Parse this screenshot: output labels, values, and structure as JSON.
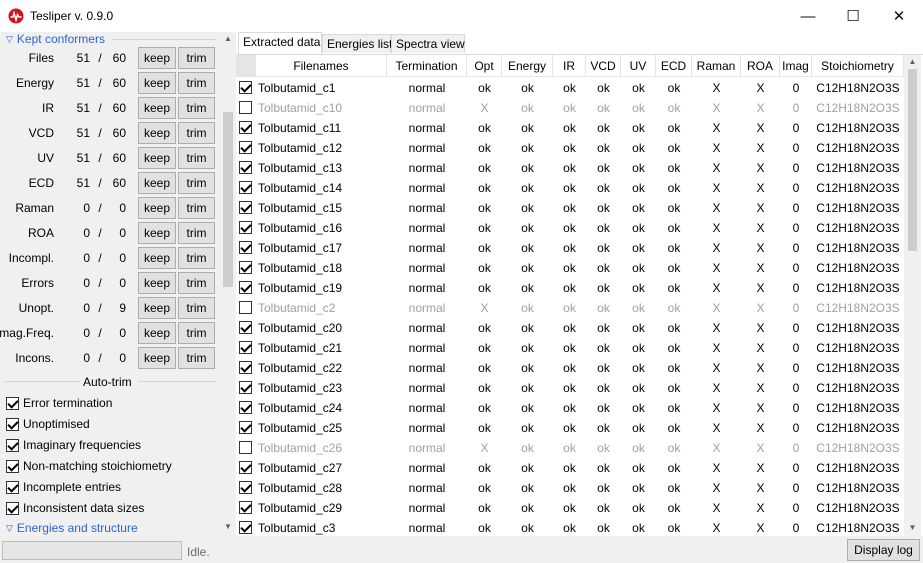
{
  "window": {
    "title": "Tesliper v. 0.9.0",
    "min_glyph": "—",
    "max_glyph": "☐",
    "close_glyph": "✕"
  },
  "left_panel": {
    "kept_conformers": {
      "label": "Kept conformers",
      "rows": [
        {
          "label": "Files",
          "kept": "51",
          "total": "60",
          "keep": "keep",
          "trim": "trim"
        },
        {
          "label": "Energy",
          "kept": "51",
          "total": "60",
          "keep": "keep",
          "trim": "trim"
        },
        {
          "label": "IR",
          "kept": "51",
          "total": "60",
          "keep": "keep",
          "trim": "trim"
        },
        {
          "label": "VCD",
          "kept": "51",
          "total": "60",
          "keep": "keep",
          "trim": "trim"
        },
        {
          "label": "UV",
          "kept": "51",
          "total": "60",
          "keep": "keep",
          "trim": "trim"
        },
        {
          "label": "ECD",
          "kept": "51",
          "total": "60",
          "keep": "keep",
          "trim": "trim"
        },
        {
          "label": "Raman",
          "kept": "0",
          "total": "0",
          "keep": "keep",
          "trim": "trim"
        },
        {
          "label": "ROA",
          "kept": "0",
          "total": "0",
          "keep": "keep",
          "trim": "trim"
        },
        {
          "label": "Incompl.",
          "kept": "0",
          "total": "0",
          "keep": "keep",
          "trim": "trim"
        },
        {
          "label": "Errors",
          "kept": "0",
          "total": "0",
          "keep": "keep",
          "trim": "trim"
        },
        {
          "label": "Unopt.",
          "kept": "0",
          "total": "9",
          "keep": "keep",
          "trim": "trim"
        },
        {
          "label": "Imag.Freq.",
          "kept": "0",
          "total": "0",
          "keep": "keep",
          "trim": "trim"
        },
        {
          "label": "Incons.",
          "kept": "0",
          "total": "0",
          "keep": "keep",
          "trim": "trim"
        }
      ],
      "separator": "/"
    },
    "auto_trim": {
      "label": "Auto-trim",
      "options": [
        {
          "label": "Error termination",
          "checked": true
        },
        {
          "label": "Unoptimised",
          "checked": true
        },
        {
          "label": "Imaginary frequencies",
          "checked": true
        },
        {
          "label": "Non-matching stoichiometry",
          "checked": true
        },
        {
          "label": "Incomplete entries",
          "checked": true
        },
        {
          "label": "Inconsistent data sizes",
          "checked": true
        }
      ]
    },
    "energies_structure": {
      "label": "Energies and structure"
    }
  },
  "tabs": [
    {
      "label": "Extracted data",
      "active": true
    },
    {
      "label": "Energies list",
      "active": false
    },
    {
      "label": "Spectra view",
      "active": false
    }
  ],
  "table": {
    "headers": [
      "",
      "Filenames",
      "Termination",
      "Opt",
      "Energy",
      "IR",
      "VCD",
      "UV",
      "ECD",
      "Raman",
      "ROA",
      "Imag",
      "Stoichiometry"
    ],
    "rows": [
      {
        "checked": true,
        "cells": [
          "Tolbutamid_c1",
          "normal",
          "ok",
          "ok",
          "ok",
          "ok",
          "ok",
          "ok",
          "X",
          "X",
          "0",
          "C12H18N2O3S"
        ]
      },
      {
        "checked": false,
        "cells": [
          "Tolbutamid_c10",
          "normal",
          "X",
          "ok",
          "ok",
          "ok",
          "ok",
          "ok",
          "X",
          "X",
          "0",
          "C12H18N2O3S"
        ]
      },
      {
        "checked": true,
        "cells": [
          "Tolbutamid_c11",
          "normal",
          "ok",
          "ok",
          "ok",
          "ok",
          "ok",
          "ok",
          "X",
          "X",
          "0",
          "C12H18N2O3S"
        ]
      },
      {
        "checked": true,
        "cells": [
          "Tolbutamid_c12",
          "normal",
          "ok",
          "ok",
          "ok",
          "ok",
          "ok",
          "ok",
          "X",
          "X",
          "0",
          "C12H18N2O3S"
        ]
      },
      {
        "checked": true,
        "cells": [
          "Tolbutamid_c13",
          "normal",
          "ok",
          "ok",
          "ok",
          "ok",
          "ok",
          "ok",
          "X",
          "X",
          "0",
          "C12H18N2O3S"
        ]
      },
      {
        "checked": true,
        "cells": [
          "Tolbutamid_c14",
          "normal",
          "ok",
          "ok",
          "ok",
          "ok",
          "ok",
          "ok",
          "X",
          "X",
          "0",
          "C12H18N2O3S"
        ]
      },
      {
        "checked": true,
        "cells": [
          "Tolbutamid_c15",
          "normal",
          "ok",
          "ok",
          "ok",
          "ok",
          "ok",
          "ok",
          "X",
          "X",
          "0",
          "C12H18N2O3S"
        ]
      },
      {
        "checked": true,
        "cells": [
          "Tolbutamid_c16",
          "normal",
          "ok",
          "ok",
          "ok",
          "ok",
          "ok",
          "ok",
          "X",
          "X",
          "0",
          "C12H18N2O3S"
        ]
      },
      {
        "checked": true,
        "cells": [
          "Tolbutamid_c17",
          "normal",
          "ok",
          "ok",
          "ok",
          "ok",
          "ok",
          "ok",
          "X",
          "X",
          "0",
          "C12H18N2O3S"
        ]
      },
      {
        "checked": true,
        "cells": [
          "Tolbutamid_c18",
          "normal",
          "ok",
          "ok",
          "ok",
          "ok",
          "ok",
          "ok",
          "X",
          "X",
          "0",
          "C12H18N2O3S"
        ]
      },
      {
        "checked": true,
        "cells": [
          "Tolbutamid_c19",
          "normal",
          "ok",
          "ok",
          "ok",
          "ok",
          "ok",
          "ok",
          "X",
          "X",
          "0",
          "C12H18N2O3S"
        ]
      },
      {
        "checked": false,
        "cells": [
          "Tolbutamid_c2",
          "normal",
          "X",
          "ok",
          "ok",
          "ok",
          "ok",
          "ok",
          "X",
          "X",
          "0",
          "C12H18N2O3S"
        ]
      },
      {
        "checked": true,
        "cells": [
          "Tolbutamid_c20",
          "normal",
          "ok",
          "ok",
          "ok",
          "ok",
          "ok",
          "ok",
          "X",
          "X",
          "0",
          "C12H18N2O3S"
        ]
      },
      {
        "checked": true,
        "cells": [
          "Tolbutamid_c21",
          "normal",
          "ok",
          "ok",
          "ok",
          "ok",
          "ok",
          "ok",
          "X",
          "X",
          "0",
          "C12H18N2O3S"
        ]
      },
      {
        "checked": true,
        "cells": [
          "Tolbutamid_c22",
          "normal",
          "ok",
          "ok",
          "ok",
          "ok",
          "ok",
          "ok",
          "X",
          "X",
          "0",
          "C12H18N2O3S"
        ]
      },
      {
        "checked": true,
        "cells": [
          "Tolbutamid_c23",
          "normal",
          "ok",
          "ok",
          "ok",
          "ok",
          "ok",
          "ok",
          "X",
          "X",
          "0",
          "C12H18N2O3S"
        ]
      },
      {
        "checked": true,
        "cells": [
          "Tolbutamid_c24",
          "normal",
          "ok",
          "ok",
          "ok",
          "ok",
          "ok",
          "ok",
          "X",
          "X",
          "0",
          "C12H18N2O3S"
        ]
      },
      {
        "checked": true,
        "cells": [
          "Tolbutamid_c25",
          "normal",
          "ok",
          "ok",
          "ok",
          "ok",
          "ok",
          "ok",
          "X",
          "X",
          "0",
          "C12H18N2O3S"
        ]
      },
      {
        "checked": false,
        "cells": [
          "Tolbutamid_c26",
          "normal",
          "X",
          "ok",
          "ok",
          "ok",
          "ok",
          "ok",
          "X",
          "X",
          "0",
          "C12H18N2O3S"
        ]
      },
      {
        "checked": true,
        "cells": [
          "Tolbutamid_c27",
          "normal",
          "ok",
          "ok",
          "ok",
          "ok",
          "ok",
          "ok",
          "X",
          "X",
          "0",
          "C12H18N2O3S"
        ]
      },
      {
        "checked": true,
        "cells": [
          "Tolbutamid_c28",
          "normal",
          "ok",
          "ok",
          "ok",
          "ok",
          "ok",
          "ok",
          "X",
          "X",
          "0",
          "C12H18N2O3S"
        ]
      },
      {
        "checked": true,
        "cells": [
          "Tolbutamid_c29",
          "normal",
          "ok",
          "ok",
          "ok",
          "ok",
          "ok",
          "ok",
          "X",
          "X",
          "0",
          "C12H18N2O3S"
        ]
      },
      {
        "checked": true,
        "cells": [
          "Tolbutamid_c3",
          "normal",
          "ok",
          "ok",
          "ok",
          "ok",
          "ok",
          "ok",
          "X",
          "X",
          "0",
          "C12H18N2O3S"
        ]
      }
    ]
  },
  "status": {
    "text": "Idle.",
    "display_log": "Display log"
  },
  "colors": {
    "accent": "#2f63d6",
    "brand_icon": "#d0101a",
    "dim_text": "#a0a0a0"
  }
}
